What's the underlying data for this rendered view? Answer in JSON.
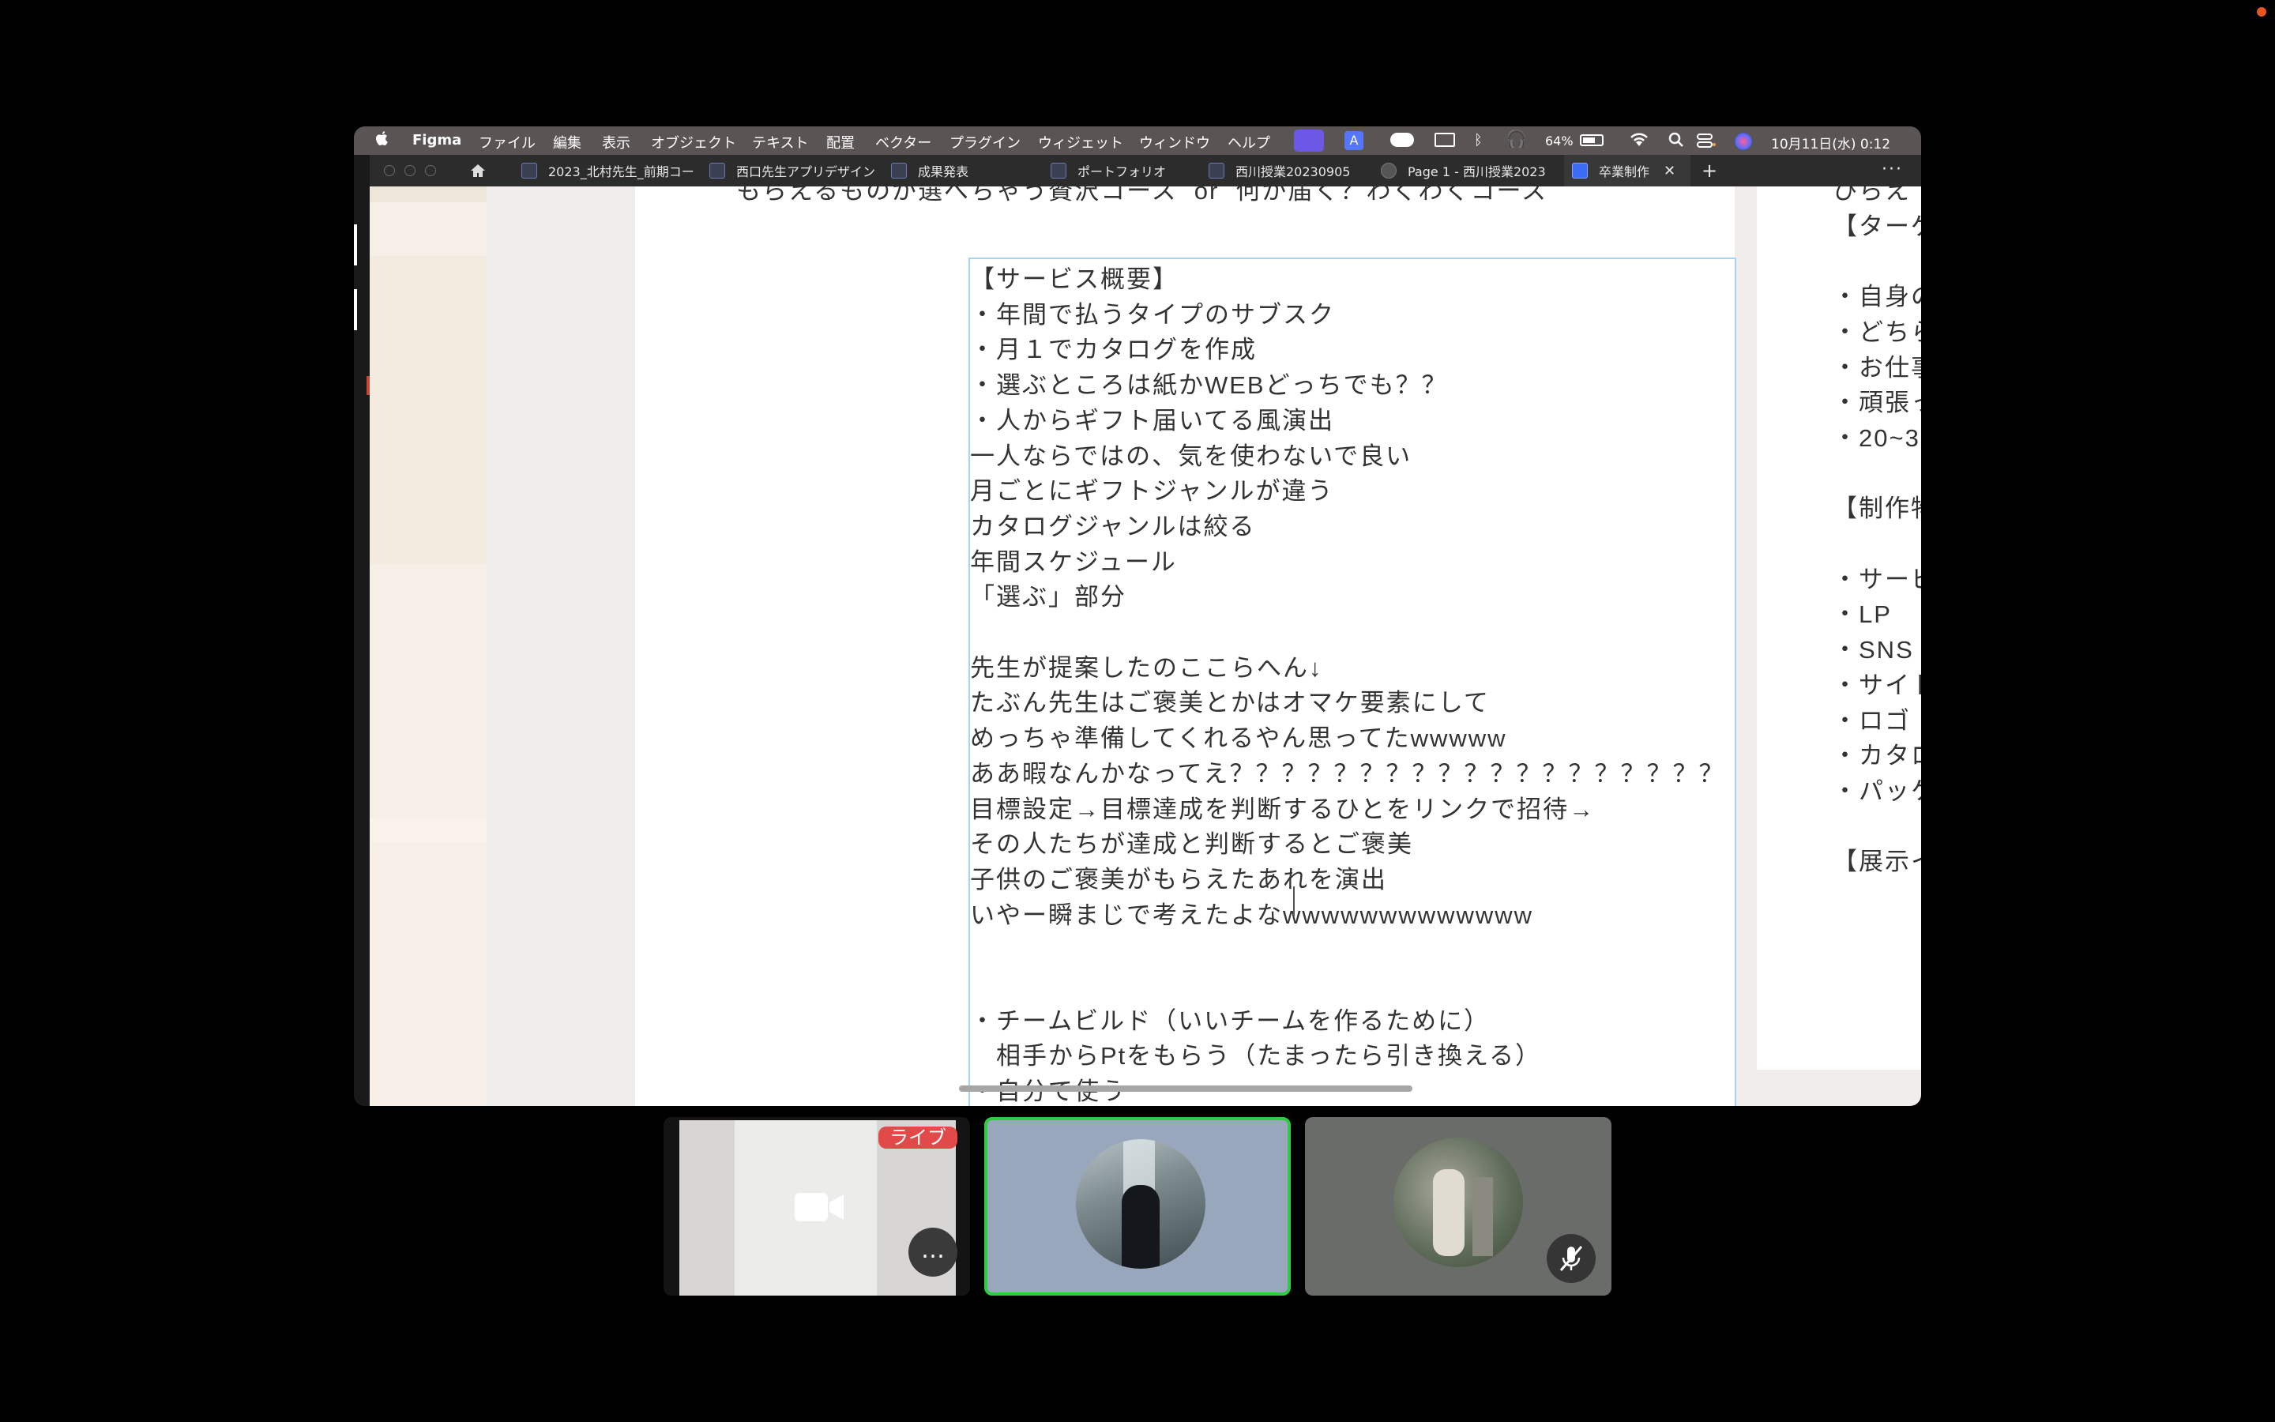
{
  "menubar": {
    "app_name": "Figma",
    "items": [
      "ファイル",
      "編集",
      "表示",
      "オブジェクト",
      "テキスト",
      "配置",
      "ベクター",
      "プラグイン",
      "ウィジェット",
      "ウィンドウ",
      "ヘルプ"
    ],
    "battery": "64%",
    "datetime": "10月11日(水) 0:12"
  },
  "tabs": [
    {
      "label": "2023_北村先生_前期コー"
    },
    {
      "label": "西口先生アプリデザイン"
    },
    {
      "label": "成果発表"
    },
    {
      "label": "ポートフォリオ"
    },
    {
      "label": "西川授業20230905"
    },
    {
      "label": "Page 1 - 西川授業2023"
    },
    {
      "label": "卒業制作",
      "active": true
    }
  ],
  "document": {
    "cut_top_line": "もらえるものが選べちゃう贅沢コース  or  何が届く？わくわくコース",
    "lines": [
      "【サービス概要】",
      "・年間で払うタイプのサブスク",
      "・月１でカタログを作成",
      "・選ぶところは紙かWEBどっちでも？？",
      "・人からギフト届いてる風演出",
      "一人ならではの、気を使わないで良い",
      "月ごとにギフトジャンルが違う",
      "カタログジャンルは絞る",
      "年間スケジュール",
      "「選ぶ」部分",
      "",
      "先生が提案したのここらへん↓",
      "たぶん先生はご褒美とかはオマケ要素にして",
      "めっちゃ準備してくれるやん思ってたwwwww",
      "ああ暇なんかなってえ？？？？？？？？？？？？？？？？？？？",
      "目標設定→目標達成を判断するひとをリンクで招待→",
      "その人たちが達成と判断するとご褒美",
      "子供のご褒美がもらえたあれを演出",
      "いやー瞬まじで考えたよなwwwwwwwwwwwww",
      "",
      "",
      "・チームビルド（いいチームを作るために）",
      "　相手からPtをもらう（たまったら引き換える）",
      "・自分で使う"
    ],
    "right_column": [
      "ひらえ",
      "【ターゲ",
      "",
      "・自身の",
      "・どちら",
      "・お仕事",
      "・頑張っ",
      "・20~3",
      "",
      "【制作物",
      "",
      "・サービ",
      "・LP",
      "・SNS",
      "・サイト",
      "・ロゴ",
      "・カタロ",
      "・パッケ",
      "",
      "【展示イ"
    ]
  },
  "participants": {
    "live_badge": "ライブ",
    "more_label": "…"
  }
}
